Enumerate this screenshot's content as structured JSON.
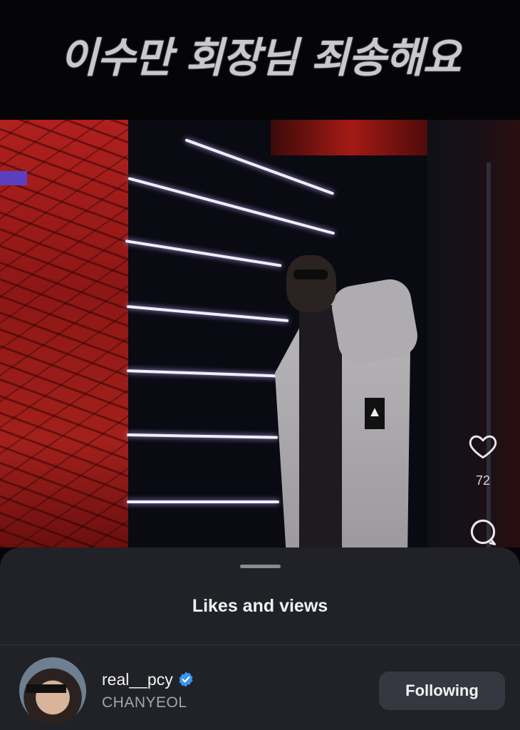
{
  "video": {
    "caption": "이수만 회장님 죄송해요",
    "likes_count": "72"
  },
  "sheet": {
    "title": "Likes and views"
  },
  "user": {
    "username": "real__pcy",
    "full_name": "CHANYEOL",
    "follow_label": "Following",
    "verified": true
  },
  "icons": {
    "like": "heart-icon",
    "comment": "comment-bubble-icon",
    "verified": "verified-badge-icon"
  },
  "colors": {
    "sheet_background": "#202227",
    "verified_blue": "#3897f0",
    "button_background": "#353840"
  }
}
